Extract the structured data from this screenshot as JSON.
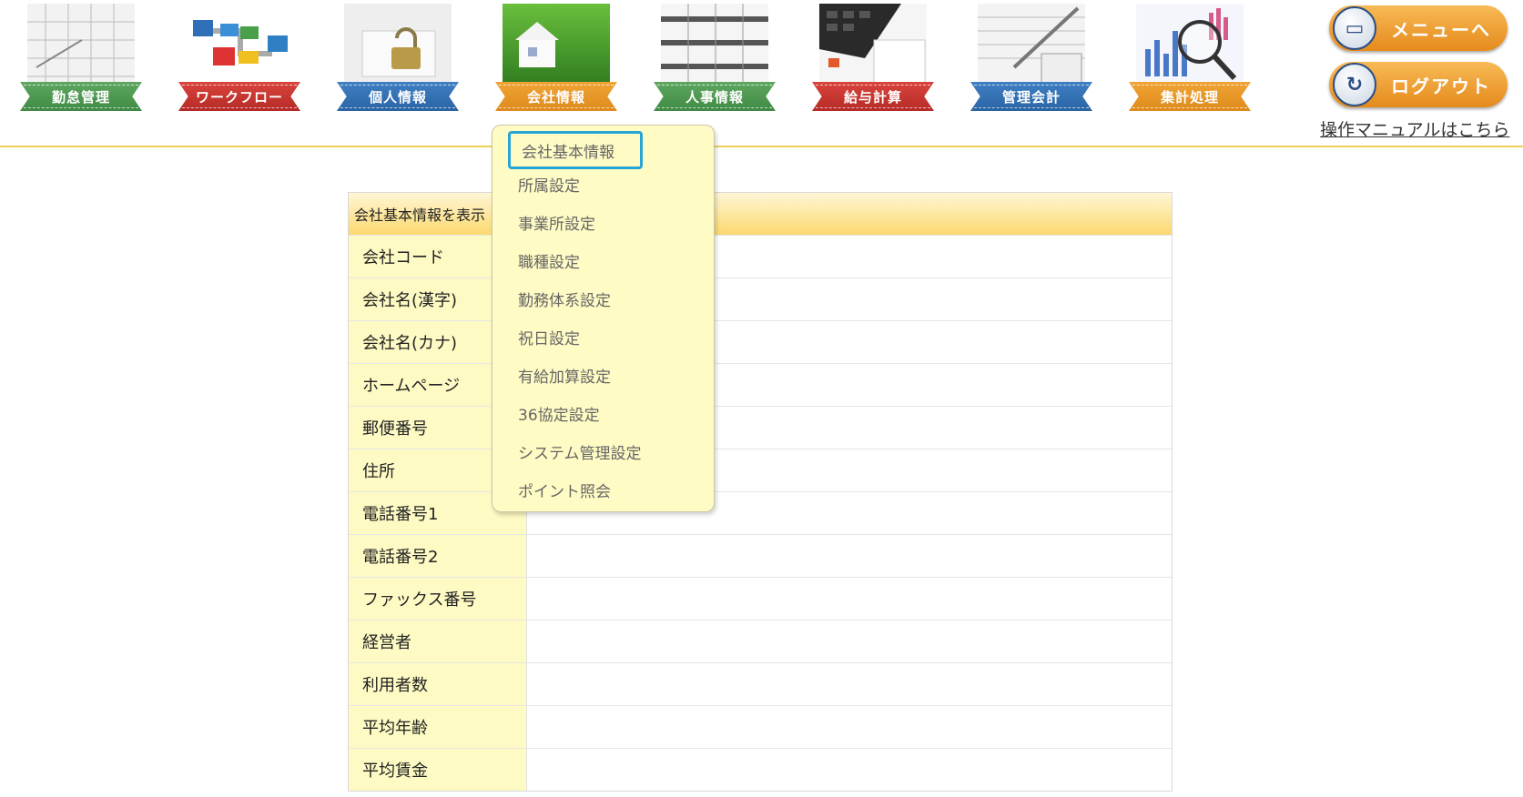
{
  "nav": {
    "items": [
      {
        "label": "勤怠管理",
        "icon": "calendar-icon",
        "color": "green"
      },
      {
        "label": "ワークフロー",
        "icon": "workflow-icon",
        "color": "red"
      },
      {
        "label": "個人情報",
        "icon": "padlock-icon",
        "color": "blue"
      },
      {
        "label": "会社情報",
        "icon": "house-icon",
        "color": "orange"
      },
      {
        "label": "人事情報",
        "icon": "file-cabinet-icon",
        "color": "green"
      },
      {
        "label": "給与計算",
        "icon": "calculator-icon",
        "color": "red"
      },
      {
        "label": "管理会計",
        "icon": "ledger-icon",
        "color": "blue"
      },
      {
        "label": "集計処理",
        "icon": "magnifier-chart-icon",
        "color": "orange"
      }
    ],
    "menu_button": "メニューへ",
    "logout_button": "ログアウト",
    "manual_link": "操作マニュアルはこちら"
  },
  "dropdown": {
    "items": [
      "会社基本情報",
      "所属設定",
      "事業所設定",
      "職種設定",
      "勤務体系設定",
      "祝日設定",
      "有給加算設定",
      "36協定設定",
      "システム管理設定",
      "ポイント照会"
    ],
    "active_index": 0
  },
  "table": {
    "header": "会社基本情報を表示",
    "rows": [
      {
        "label": "会社コード",
        "value": ""
      },
      {
        "label": "会社名(漢字)",
        "value": ""
      },
      {
        "label": "会社名(カナ)",
        "value": ""
      },
      {
        "label": "ホームページ",
        "value": ""
      },
      {
        "label": "郵便番号",
        "value": ""
      },
      {
        "label": "住所",
        "value": ""
      },
      {
        "label": "電話番号1",
        "value": ""
      },
      {
        "label": "電話番号2",
        "value": ""
      },
      {
        "label": "ファックス番号",
        "value": ""
      },
      {
        "label": "経営者",
        "value": ""
      },
      {
        "label": "利用者数",
        "value": ""
      },
      {
        "label": "平均年齢",
        "value": ""
      },
      {
        "label": "平均賃金",
        "value": ""
      }
    ]
  }
}
